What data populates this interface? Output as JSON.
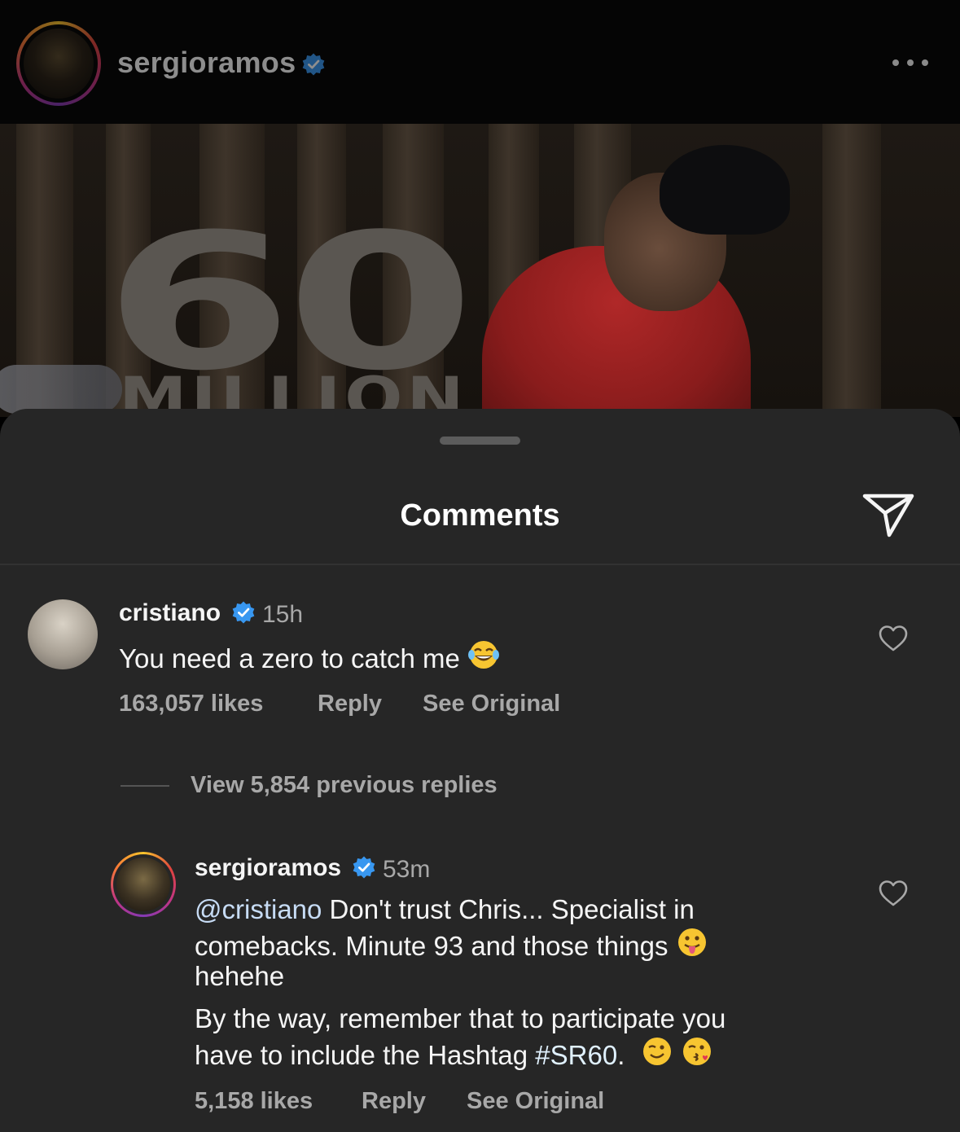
{
  "post": {
    "username": "sergioramos",
    "image_text": {
      "number": "60",
      "word": "MILLION"
    },
    "more_icon": "more-horizontal-icon"
  },
  "comments_sheet": {
    "title": "Comments",
    "share_icon": "send-icon",
    "colors": {
      "background": "#262626",
      "secondary_text": "#a8a8a8",
      "verified": "#3897f0"
    }
  },
  "comments": [
    {
      "username": "cristiano",
      "time": "15h",
      "text": "You need a zero to catch me",
      "emoji": "joy-emoji",
      "likes": "163,057 likes",
      "reply_label": "Reply",
      "see_original_label": "See Original"
    }
  ],
  "replies_toggle": {
    "label": "View 5,854 previous replies"
  },
  "reply": {
    "username": "sergioramos",
    "time": "53m",
    "mention": "@cristiano",
    "line1_rest": " Don't trust Chris... Specialist in",
    "line2": "comebacks. Minute 93 and those things",
    "line3": "hehehe",
    "line4": "By the way, remember that to participate you",
    "line5_start": "have to include the Hashtag ",
    "hashtag": "#SR60",
    "line5_end": ".",
    "emojis": [
      "tongue-emoji",
      "wink-emoji",
      "kiss-emoji"
    ],
    "likes": "5,158 likes",
    "reply_label": "Reply",
    "see_original_label": "See Original"
  }
}
